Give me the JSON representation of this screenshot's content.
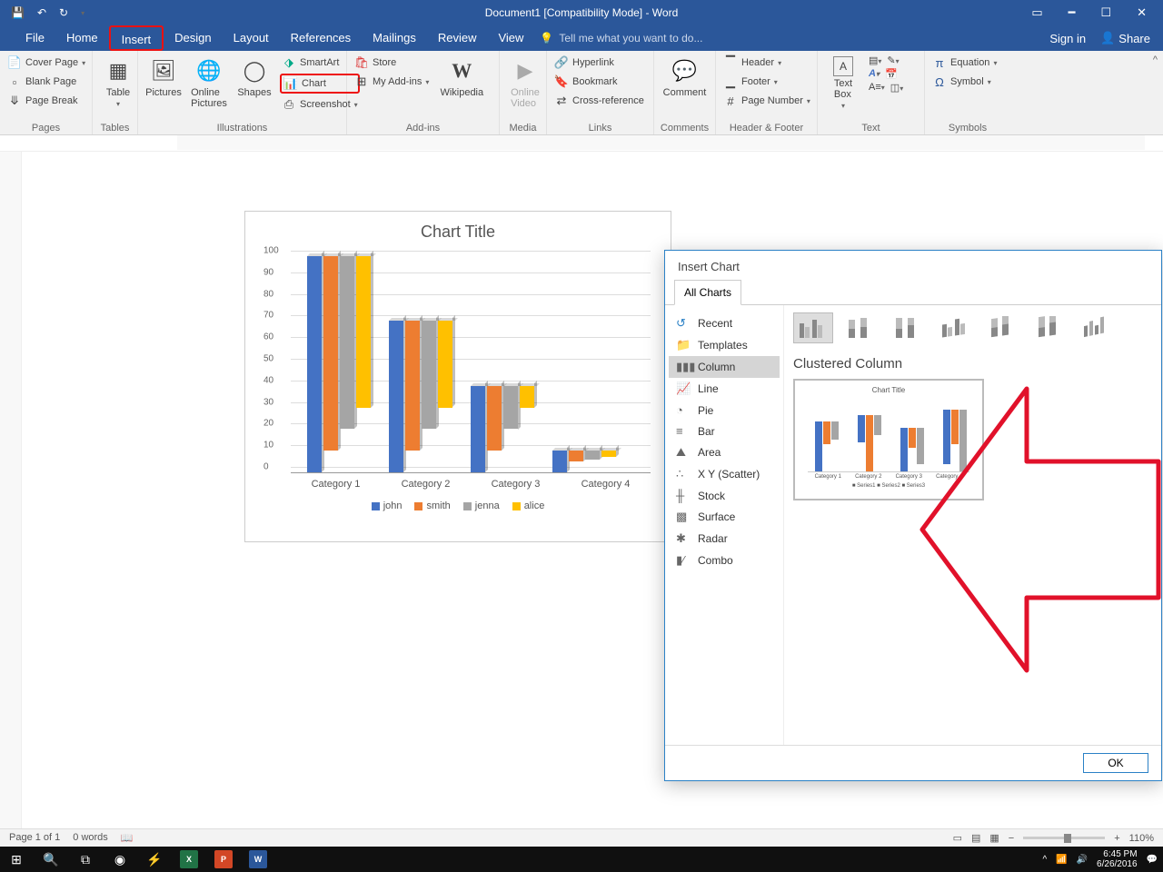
{
  "titlebar": {
    "title": "Document1 [Compatibility Mode] - Word"
  },
  "tabs": {
    "items": [
      "File",
      "Home",
      "Insert",
      "Design",
      "Layout",
      "References",
      "Mailings",
      "Review",
      "View"
    ],
    "tellme": "Tell me what you want to do...",
    "signin": "Sign in",
    "share": "Share"
  },
  "ribbon": {
    "pages": {
      "label": "Pages",
      "cover": "Cover Page",
      "blank": "Blank Page",
      "break": "Page Break"
    },
    "tables": {
      "label": "Tables",
      "table": "Table"
    },
    "illustrations": {
      "label": "Illustrations",
      "pictures": "Pictures",
      "online": "Online\nPictures",
      "shapes": "Shapes",
      "smartart": "SmartArt",
      "chart": "Chart",
      "screenshot": "Screenshot"
    },
    "addins": {
      "label": "Add-ins",
      "store": "Store",
      "myaddins": "My Add-ins",
      "wikipedia": "Wikipedia"
    },
    "media": {
      "label": "Media",
      "video": "Online\nVideo"
    },
    "links": {
      "label": "Links",
      "hyperlink": "Hyperlink",
      "bookmark": "Bookmark",
      "crossref": "Cross-reference"
    },
    "comments": {
      "label": "Comments",
      "comment": "Comment"
    },
    "hf": {
      "label": "Header & Footer",
      "header": "Header",
      "footer": "Footer",
      "pagenum": "Page Number"
    },
    "text": {
      "label": "Text",
      "textbox": "Text\nBox"
    },
    "symbols": {
      "label": "Symbols",
      "equation": "Equation",
      "symbol": "Symbol"
    }
  },
  "chart_data": {
    "type": "bar",
    "title": "Chart Title",
    "categories": [
      "Category 1",
      "Category 2",
      "Category 3",
      "Category 4"
    ],
    "series": [
      {
        "name": "john",
        "color": "#4472c4",
        "values": [
          100,
          70,
          40,
          10
        ]
      },
      {
        "name": "smith",
        "color": "#ed7d31",
        "values": [
          90,
          60,
          30,
          5
        ]
      },
      {
        "name": "jenna",
        "color": "#a5a5a5",
        "values": [
          80,
          50,
          20,
          4
        ]
      },
      {
        "name": "alice",
        "color": "#ffc000",
        "values": [
          70,
          40,
          10,
          3
        ]
      }
    ],
    "ylim": [
      0,
      100
    ],
    "yticks": [
      0,
      10,
      20,
      30,
      40,
      50,
      60,
      70,
      80,
      90,
      100
    ]
  },
  "dialog": {
    "title": "Insert Chart",
    "tab": "All Charts",
    "side": [
      "Recent",
      "Templates",
      "Column",
      "Line",
      "Pie",
      "Bar",
      "Area",
      "X Y (Scatter)",
      "Stock",
      "Surface",
      "Radar",
      "Combo"
    ],
    "subtitle": "Clustered Column",
    "ok": "OK",
    "preview": {
      "title": "Chart Title",
      "categories": [
        "Category 1",
        "Category 2",
        "Category 3",
        "Category 4"
      ],
      "legend": "■ Series1   ■ Series2   ■ Series3"
    }
  },
  "status": {
    "page": "Page 1 of 1",
    "words": "0 words",
    "zoom": "110%"
  },
  "system": {
    "time": "6:45 PM",
    "date": "6/26/2016"
  }
}
